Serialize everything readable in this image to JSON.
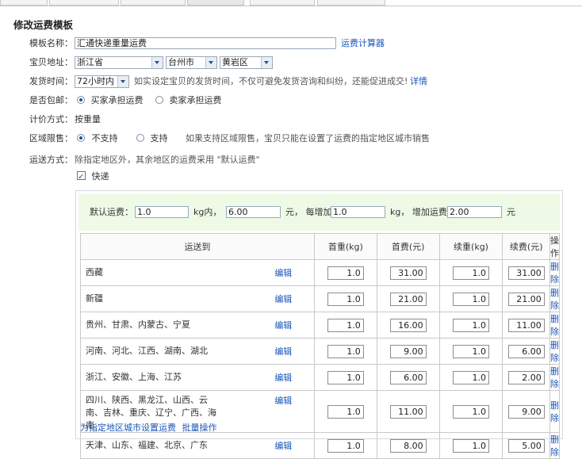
{
  "page_title": "修改运费模板",
  "form": {
    "name_label": "模板名称：",
    "name_value": "汇通快递重量运费",
    "calc_link": "运费计算器",
    "address_label": "宝贝地址：",
    "province": "浙江省",
    "city": "台州市",
    "district": "黄岩区",
    "ship_time_label": "发货时间：",
    "ship_time": "72小时内",
    "ship_hint": "如实设定宝贝的发货时间，不仅可避免发货咨询和纠纷，还能促进成交!",
    "ship_detail_link": "详情",
    "free_label": "是否包邮：",
    "buyer_pays": "买家承担运费",
    "seller_pays": "卖家承担运费",
    "pricing_label": "计价方式：",
    "pricing_value": "按重量",
    "region_label": "区域限售：",
    "region_no": "不支持",
    "region_yes": "支持",
    "region_hint": "如果支持区域限售，宝贝只能在设置了运费的指定地区城市销售",
    "delivery_label": "运送方式：",
    "delivery_hint": "除指定地区外，其余地区的运费采用 \"默认运费\"",
    "express_label": "快递"
  },
  "default_fee": {
    "label": "默认运费：",
    "first_weight": "1.0",
    "unit1": "kg内，",
    "first_fee": "6.00",
    "unit2": "元，  每增加",
    "add_weight": "1.0",
    "unit3": "kg，  增加运费",
    "add_fee": "2.00",
    "unit4": "元"
  },
  "table": {
    "headers": [
      "运送到",
      "首重(kg)",
      "首费(元)",
      "续重(kg)",
      "续费(元)",
      "操作"
    ],
    "edit_label": "编辑",
    "delete_label": "删除",
    "rows": [
      {
        "region": "西藏",
        "first_w": "1.0",
        "first_fee": "31.00",
        "add_w": "1.0",
        "add_fee": "31.00"
      },
      {
        "region": "新疆",
        "first_w": "1.0",
        "first_fee": "21.00",
        "add_w": "1.0",
        "add_fee": "21.00"
      },
      {
        "region": "贵州、甘肃、内蒙古、宁夏",
        "first_w": "1.0",
        "first_fee": "16.00",
        "add_w": "1.0",
        "add_fee": "11.00"
      },
      {
        "region": "河南、河北、江西、湖南、湖北",
        "first_w": "1.0",
        "first_fee": "9.00",
        "add_w": "1.0",
        "add_fee": "6.00"
      },
      {
        "region": "浙江、安徽、上海、江苏",
        "first_w": "1.0",
        "first_fee": "6.00",
        "add_w": "1.0",
        "add_fee": "2.00"
      },
      {
        "region_lines": [
          "四川、陕西、黑龙江、山西、云",
          "南、吉林、重庆、辽宁、广西、海",
          "南"
        ],
        "first_w": "1.0",
        "first_fee": "11.00",
        "add_w": "1.0",
        "add_fee": "9.00"
      },
      {
        "region": "天津、山东、福建、北京、广东",
        "first_w": "1.0",
        "first_fee": "8.00",
        "add_w": "1.0",
        "add_fee": "5.00"
      }
    ]
  },
  "bottom_links": {
    "set_region": "为指定地区城市设置运费",
    "batch": "批量操作"
  }
}
